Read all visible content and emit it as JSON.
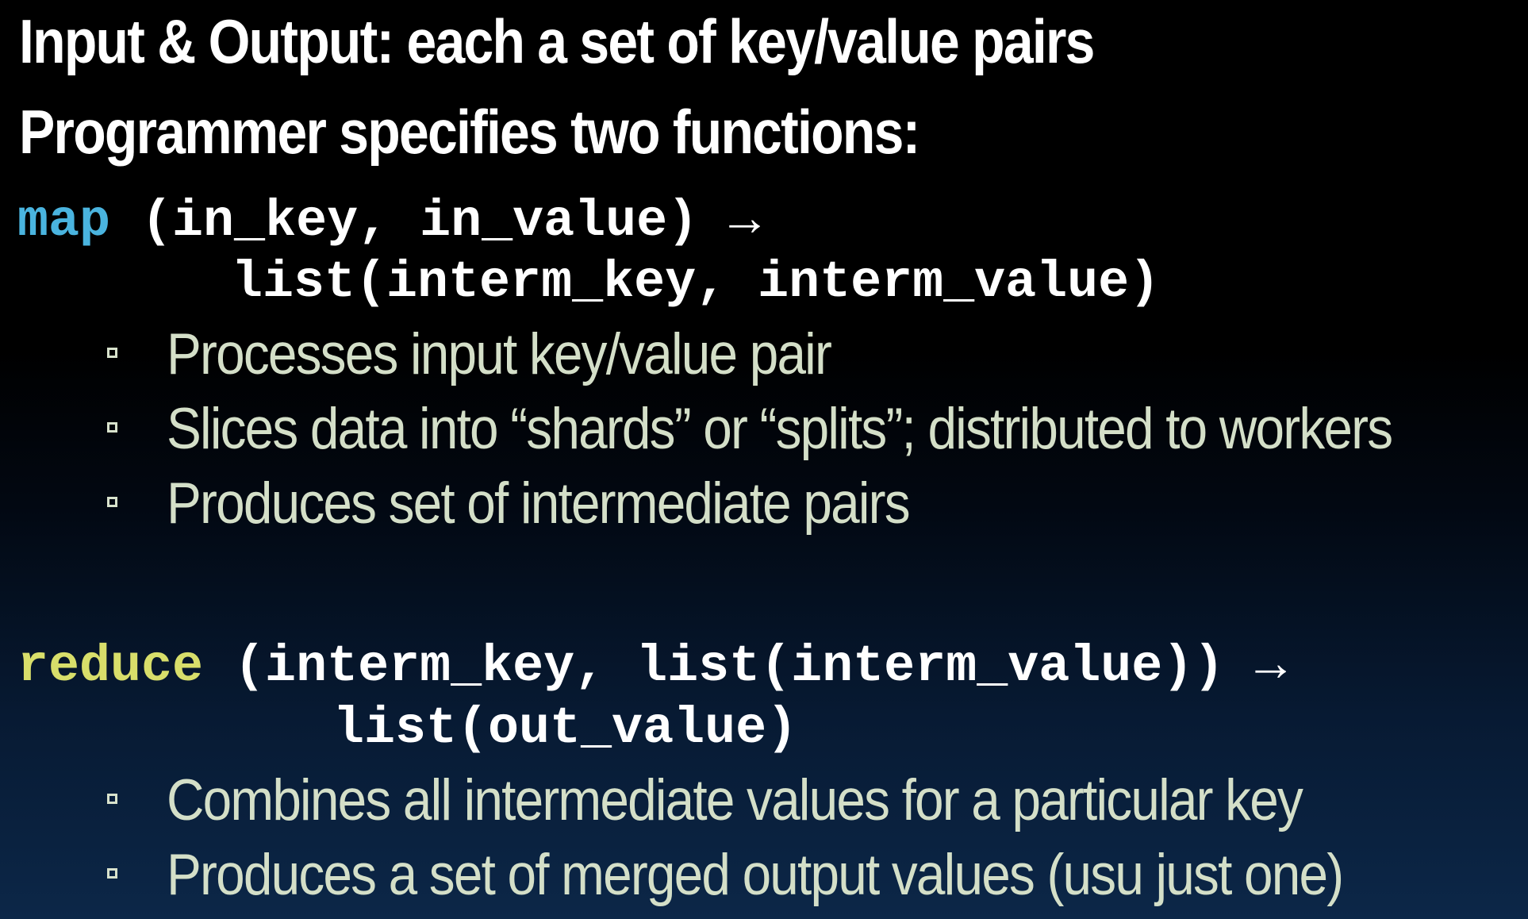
{
  "headings": {
    "line1": "Input & Output: each a set of key/value pairs",
    "line2": "Programmer specifies two functions:"
  },
  "map_signature": {
    "keyword": "map",
    "args": " (in_key, in_value) →",
    "returns": "list(interm_key, interm_value)"
  },
  "map_bullets": [
    "Processes input key/value pair",
    "Slices data into “shards” or “splits”; distributed to workers",
    "Produces set of intermediate pairs"
  ],
  "reduce_signature": {
    "keyword": "reduce",
    "args": " (interm_key, list(interm_value)) →",
    "returns": "list(out_value)"
  },
  "reduce_bullets": [
    "Combines all intermediate values for a particular key",
    "Produces a set of merged output values (usu just one)"
  ],
  "colors": {
    "map_keyword": "#4ab4df",
    "reduce_keyword": "#d8de6a",
    "bullet_text": "#d4dfc8",
    "heading_text": "#ffffff",
    "code_text": "#ffffff"
  }
}
